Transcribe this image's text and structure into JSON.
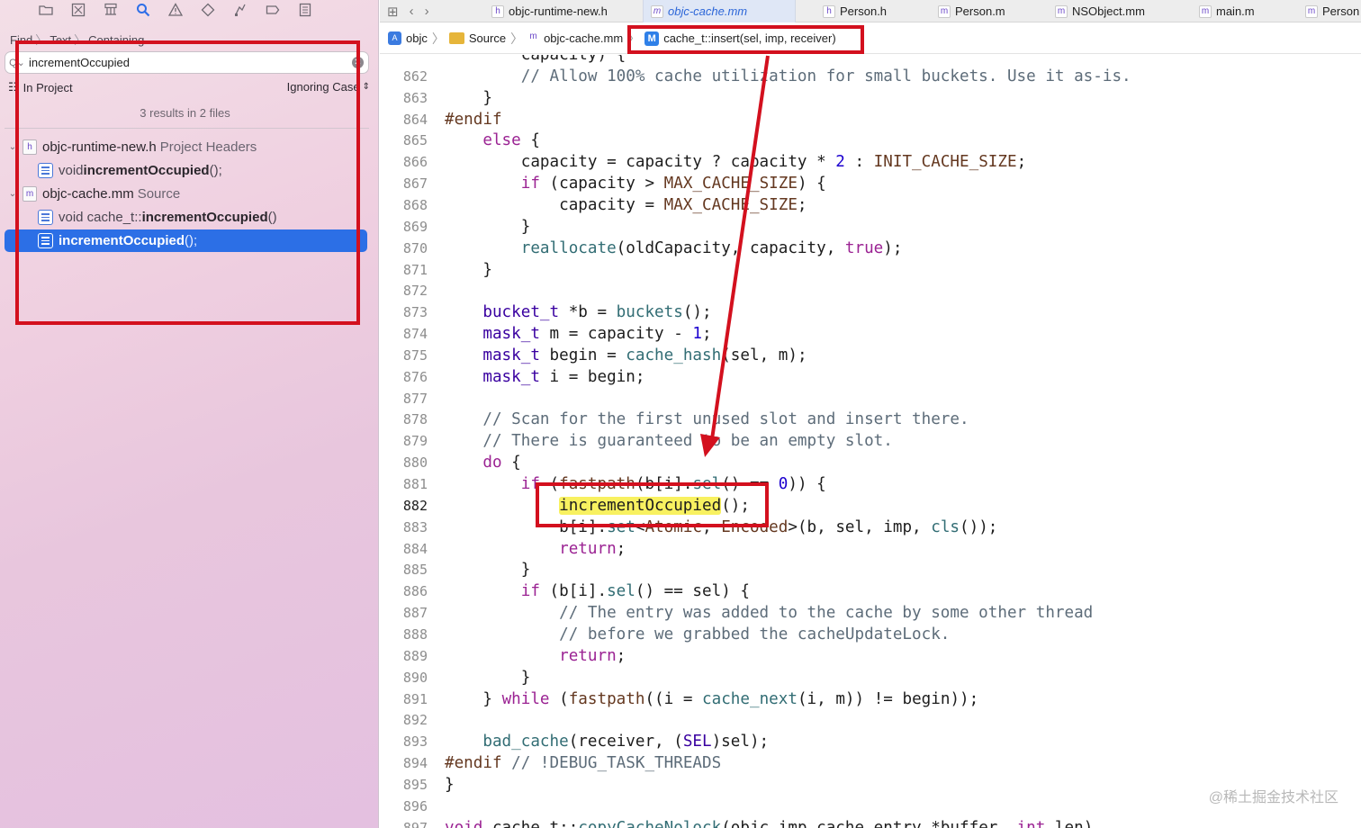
{
  "navigator": {
    "toolbar_icons": [
      "folder-icon",
      "source-control-icon",
      "hierarchy-icon",
      "search-icon",
      "warning-icon",
      "test-icon",
      "debug-icon",
      "breakpoint-icon",
      "report-icon"
    ],
    "find_breadcrumb": [
      "Find",
      "Text",
      "Containing"
    ],
    "search": {
      "value": "incrementOccupied",
      "placeholder": ""
    },
    "scope": "In Project",
    "case_mode": "Ignoring Case",
    "results_summary": "3 results in 2 files",
    "results": [
      {
        "file": "objc-runtime-new.h",
        "file_badge": "h",
        "group": "Project Headers",
        "matches": [
          {
            "pre": "void ",
            "hit": "incrementOccupied",
            "post": "();",
            "selected": false
          }
        ]
      },
      {
        "file": "objc-cache.mm",
        "file_badge": "m",
        "group": "Source",
        "matches": [
          {
            "pre": "void cache_t::",
            "hit": "incrementOccupied",
            "post": "()",
            "selected": false
          },
          {
            "pre": "",
            "hit": "incrementOccupied",
            "post": "();",
            "selected": true
          }
        ]
      }
    ]
  },
  "editor": {
    "tabs": [
      {
        "icon": "h",
        "label": "objc-runtime-new.h",
        "active": false
      },
      {
        "icon": "m",
        "label": "objc-cache.mm",
        "active": true
      },
      {
        "icon": "h",
        "label": "Person.h",
        "active": false
      },
      {
        "icon": "m",
        "label": "Person.m",
        "active": false
      },
      {
        "icon": "m",
        "label": "NSObject.mm",
        "active": false
      },
      {
        "icon": "m",
        "label": "main.m",
        "active": false
      },
      {
        "icon": "m",
        "label": "Person",
        "active": false
      }
    ],
    "jump_bar": {
      "project": "objc",
      "folder": "Source",
      "file": "objc-cache.mm",
      "method_badge": "M",
      "method": "cache_t::insert(sel, imp, receiver)"
    },
    "current_line": "882",
    "lines": [
      {
        "n": "",
        "t": [
          [
            "",
            "        capacity) {"
          ]
        ]
      },
      {
        "n": "862",
        "t": [
          [
            "cm",
            "        // Allow 100% cache utilization for small buckets. Use it as-is."
          ]
        ]
      },
      {
        "n": "863",
        "t": [
          [
            "",
            "    }"
          ]
        ]
      },
      {
        "n": "864",
        "t": [
          [
            "pp",
            "#endif"
          ]
        ]
      },
      {
        "n": "865",
        "t": [
          [
            "kw",
            "    else"
          ],
          [
            "",
            " {"
          ]
        ]
      },
      {
        "n": "866",
        "t": [
          [
            "",
            "        capacity = capacity ? capacity * "
          ],
          [
            "num",
            "2"
          ],
          [
            "",
            " : "
          ],
          [
            "mc",
            "INIT_CACHE_SIZE"
          ],
          [
            "",
            ";"
          ]
        ]
      },
      {
        "n": "867",
        "t": [
          [
            "kw",
            "        if"
          ],
          [
            "",
            " (capacity > "
          ],
          [
            "mc",
            "MAX_CACHE_SIZE"
          ],
          [
            "",
            ") {"
          ]
        ]
      },
      {
        "n": "868",
        "t": [
          [
            "",
            "            capacity = "
          ],
          [
            "mc",
            "MAX_CACHE_SIZE"
          ],
          [
            "",
            ";"
          ]
        ]
      },
      {
        "n": "869",
        "t": [
          [
            "",
            "        }"
          ]
        ]
      },
      {
        "n": "870",
        "t": [
          [
            "fn",
            "        reallocate"
          ],
          [
            "",
            "(oldCapacity, capacity, "
          ],
          [
            "kw",
            "true"
          ],
          [
            "",
            ");"
          ]
        ]
      },
      {
        "n": "871",
        "t": [
          [
            "",
            "    }"
          ]
        ]
      },
      {
        "n": "872",
        "t": [
          [
            "",
            ""
          ]
        ]
      },
      {
        "n": "873",
        "t": [
          [
            "ty",
            "    bucket_t"
          ],
          [
            "",
            " *b = "
          ],
          [
            "fn",
            "buckets"
          ],
          [
            "",
            "();"
          ]
        ]
      },
      {
        "n": "874",
        "t": [
          [
            "ty",
            "    mask_t"
          ],
          [
            "",
            " m = capacity - "
          ],
          [
            "num",
            "1"
          ],
          [
            "",
            ";"
          ]
        ]
      },
      {
        "n": "875",
        "t": [
          [
            "ty",
            "    mask_t"
          ],
          [
            "",
            " begin = "
          ],
          [
            "fn",
            "cache_hash"
          ],
          [
            "",
            "(sel, m);"
          ]
        ]
      },
      {
        "n": "876",
        "t": [
          [
            "ty",
            "    mask_t"
          ],
          [
            "",
            " i = begin;"
          ]
        ]
      },
      {
        "n": "877",
        "t": [
          [
            "",
            ""
          ]
        ]
      },
      {
        "n": "878",
        "t": [
          [
            "cm",
            "    // Scan for the first unused slot and insert there."
          ]
        ]
      },
      {
        "n": "879",
        "t": [
          [
            "cm",
            "    // There is guaranteed to be an empty slot."
          ]
        ]
      },
      {
        "n": "880",
        "t": [
          [
            "kw",
            "    do"
          ],
          [
            "",
            " {"
          ]
        ]
      },
      {
        "n": "881",
        "t": [
          [
            "kw",
            "        if"
          ],
          [
            "",
            " ("
          ],
          [
            "mc",
            "fastpath"
          ],
          [
            "",
            "(b[i]."
          ],
          [
            "fn",
            "sel"
          ],
          [
            "",
            "() == "
          ],
          [
            "num",
            "0"
          ],
          [
            "",
            ")) {"
          ]
        ]
      },
      {
        "n": "882",
        "t": [
          [
            "",
            "            "
          ],
          [
            "hl",
            "incrementOccupied"
          ],
          [
            "",
            "();"
          ]
        ]
      },
      {
        "n": "883",
        "t": [
          [
            "",
            "            b[i]."
          ],
          [
            "fn",
            "set"
          ],
          [
            "",
            "<"
          ],
          [
            "mc",
            "Atomic"
          ],
          [
            "",
            ", "
          ],
          [
            "mc",
            "Encoded"
          ],
          [
            "",
            ">(b, sel, imp, "
          ],
          [
            "fn",
            "cls"
          ],
          [
            "",
            "());"
          ]
        ]
      },
      {
        "n": "884",
        "t": [
          [
            "kw",
            "            return"
          ],
          [
            "",
            ";"
          ]
        ]
      },
      {
        "n": "885",
        "t": [
          [
            "",
            "        }"
          ]
        ]
      },
      {
        "n": "886",
        "t": [
          [
            "kw",
            "        if"
          ],
          [
            "",
            " (b[i]."
          ],
          [
            "fn",
            "sel"
          ],
          [
            "",
            "() == sel) {"
          ]
        ]
      },
      {
        "n": "887",
        "t": [
          [
            "cm",
            "            // The entry was added to the cache by some other thread"
          ]
        ]
      },
      {
        "n": "888",
        "t": [
          [
            "cm",
            "            // before we grabbed the cacheUpdateLock."
          ]
        ]
      },
      {
        "n": "889",
        "t": [
          [
            "kw",
            "            return"
          ],
          [
            "",
            ";"
          ]
        ]
      },
      {
        "n": "890",
        "t": [
          [
            "",
            "        }"
          ]
        ]
      },
      {
        "n": "891",
        "t": [
          [
            "",
            "    } "
          ],
          [
            "kw",
            "while"
          ],
          [
            "",
            " ("
          ],
          [
            "mc",
            "fastpath"
          ],
          [
            "",
            "((i = "
          ],
          [
            "fn",
            "cache_next"
          ],
          [
            "",
            "(i, m)) != begin));"
          ]
        ]
      },
      {
        "n": "892",
        "t": [
          [
            "",
            ""
          ]
        ]
      },
      {
        "n": "893",
        "t": [
          [
            "fn",
            "    bad_cache"
          ],
          [
            "",
            "(receiver, ("
          ],
          [
            "ty",
            "SEL"
          ],
          [
            "",
            ")sel);"
          ]
        ]
      },
      {
        "n": "894",
        "t": [
          [
            "pp",
            "#endif"
          ],
          [
            "cm",
            " // !DEBUG_TASK_THREADS"
          ]
        ]
      },
      {
        "n": "895",
        "t": [
          [
            "",
            "}"
          ]
        ]
      },
      {
        "n": "896",
        "t": [
          [
            "",
            ""
          ]
        ]
      },
      {
        "n": "897",
        "t": [
          [
            "kw",
            "void"
          ],
          [
            "",
            " cache_t::"
          ],
          [
            "fn",
            "copyCacheNolock"
          ],
          [
            "",
            "(objc_imp_cache_entry *buffer, "
          ],
          [
            "kw",
            "int"
          ],
          [
            "",
            " len)"
          ]
        ]
      }
    ]
  },
  "watermark": "@稀土掘金技术社区",
  "colors": {
    "selection": "#2c6fe6",
    "annotation_red": "#d3101e",
    "match_highlight": "#f8f160"
  }
}
